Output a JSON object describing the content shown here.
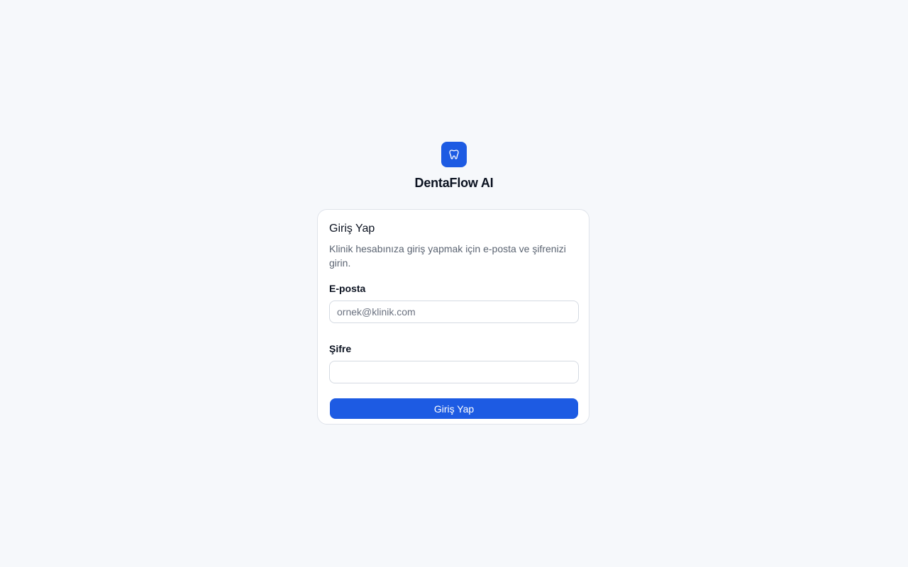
{
  "brand": {
    "logo_icon": "tooth-icon",
    "app_name": "DentaFlow AI",
    "accent_color": "#1d5be3"
  },
  "login_card": {
    "title": "Giriş Yap",
    "description": "Klinik hesabınıza giriş yapmak için e-posta ve şifrenizi girin.",
    "email": {
      "label": "E-posta",
      "placeholder": "ornek@klinik.com",
      "value": ""
    },
    "password": {
      "label": "Şifre",
      "placeholder": "",
      "value": ""
    },
    "submit_label": "Giriş Yap"
  }
}
